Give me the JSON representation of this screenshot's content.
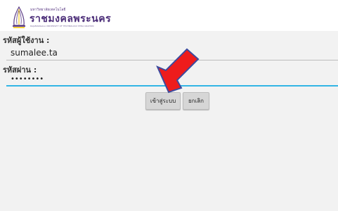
{
  "header": {
    "logo_icon": "university-seal-icon",
    "logo_subtitle": "มหาวิทยาลัยเทคโนโลยี",
    "logo_title": "ราชมงคลพระนคร",
    "logo_tagline": "RAJAMANGALA UNIVERSITY OF TECHNOLOGY PHRA NAKHON"
  },
  "login": {
    "username_label": "รหัสผู้ใช้งาน :",
    "username_value": "sumalee.ta",
    "password_label": "รหัสผ่าน :",
    "password_value": "••••••••",
    "login_button": "เข้าสู่ระบบ",
    "cancel_button": "ยกเลิก"
  },
  "annotation": {
    "arrow_icon": "red-arrow-icon",
    "arrow_color": "#ee1c1c"
  },
  "colors": {
    "brand": "#4b2d78",
    "focus_underline": "#33b5e5",
    "background": "#f2f2f2"
  }
}
